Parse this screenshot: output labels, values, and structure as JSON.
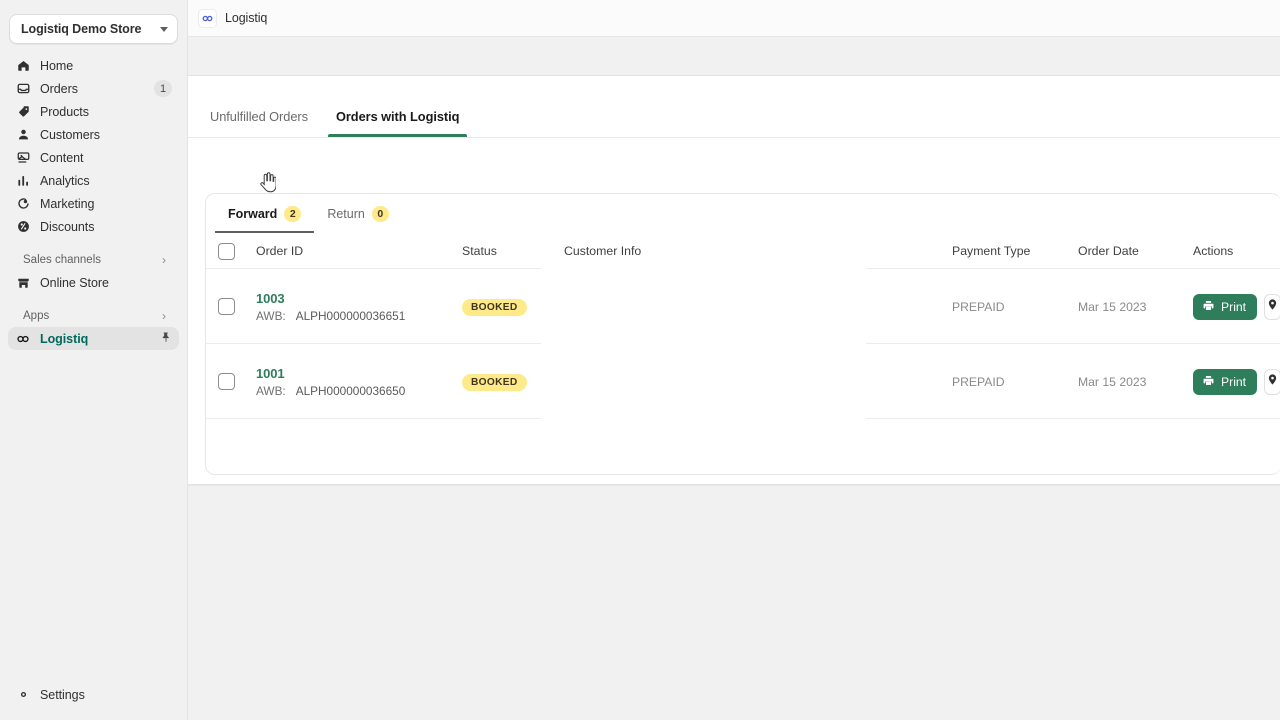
{
  "sidebar": {
    "store": {
      "name": "Logistiq Demo Store",
      "caret_icon": "chevron-down-icon"
    },
    "items": [
      {
        "label": "Home",
        "icon": "home-icon",
        "count": ""
      },
      {
        "label": "Orders",
        "icon": "orders-inbox-icon",
        "count": "1"
      },
      {
        "label": "Products",
        "icon": "product-tag-icon",
        "count": ""
      },
      {
        "label": "Customers",
        "icon": "customer-person-icon",
        "count": ""
      },
      {
        "label": "Content",
        "icon": "content-image-icon",
        "count": ""
      },
      {
        "label": "Analytics",
        "icon": "analytics-bars-icon",
        "count": ""
      },
      {
        "label": "Marketing",
        "icon": "marketing-target-icon",
        "count": ""
      },
      {
        "label": "Discounts",
        "icon": "discount-percent-icon",
        "count": ""
      }
    ],
    "sales_channels": {
      "title": "Sales channels",
      "chevron_icon": "chevron-right-icon"
    },
    "online_store": {
      "label": "Online Store",
      "icon": "storefront-icon"
    },
    "apps": {
      "title": "Apps",
      "chevron_icon": "chevron-right-icon"
    },
    "app_item": {
      "label": "Logistiq",
      "icon": "logistiq-infinity-icon",
      "pin_icon": "pin-icon"
    },
    "settings": {
      "label": "Settings",
      "icon": "gear-icon"
    }
  },
  "appbar": {
    "title": "Logistiq",
    "icon": "logistiq-infinity-icon"
  },
  "tabs": [
    {
      "label": "Unfulfilled Orders",
      "active": false
    },
    {
      "label": "Orders with Logistiq",
      "active": true
    }
  ],
  "subtabs": [
    {
      "label": "Forward",
      "badge": "2",
      "active": true
    },
    {
      "label": "Return",
      "badge": "0",
      "active": false
    }
  ],
  "table": {
    "columns": [
      "Order ID",
      "Status",
      "Customer Info",
      "Payment Type",
      "Order Date",
      "Actions"
    ],
    "select_all_checkbox": "unchecked",
    "awb_label": "AWB:",
    "rows": [
      {
        "order_id": "1003",
        "awb": "ALPH000000036651",
        "status": "BOOKED",
        "customer_info": "",
        "payment_type": "PREPAID",
        "order_date": "Mar 15 2023",
        "print_label": "Print",
        "print_icon": "printer-icon",
        "track_icon": "map-pin-icon"
      },
      {
        "order_id": "1001",
        "awb": "ALPH000000036650",
        "status": "BOOKED",
        "customer_info": "",
        "payment_type": "PREPAID",
        "order_date": "Mar 15 2023",
        "print_label": "Print",
        "print_icon": "printer-icon",
        "track_icon": "map-pin-icon"
      }
    ]
  },
  "colors": {
    "brand_green": "#2e7d5b",
    "badge_yellow": "#ffea8a",
    "app_icon_blue": "#4a5ce0",
    "sidebar_bg": "#f1f1f1",
    "panel_bg": "#ffffff"
  },
  "cursor": {
    "icon": "pointing-hand-cursor"
  }
}
